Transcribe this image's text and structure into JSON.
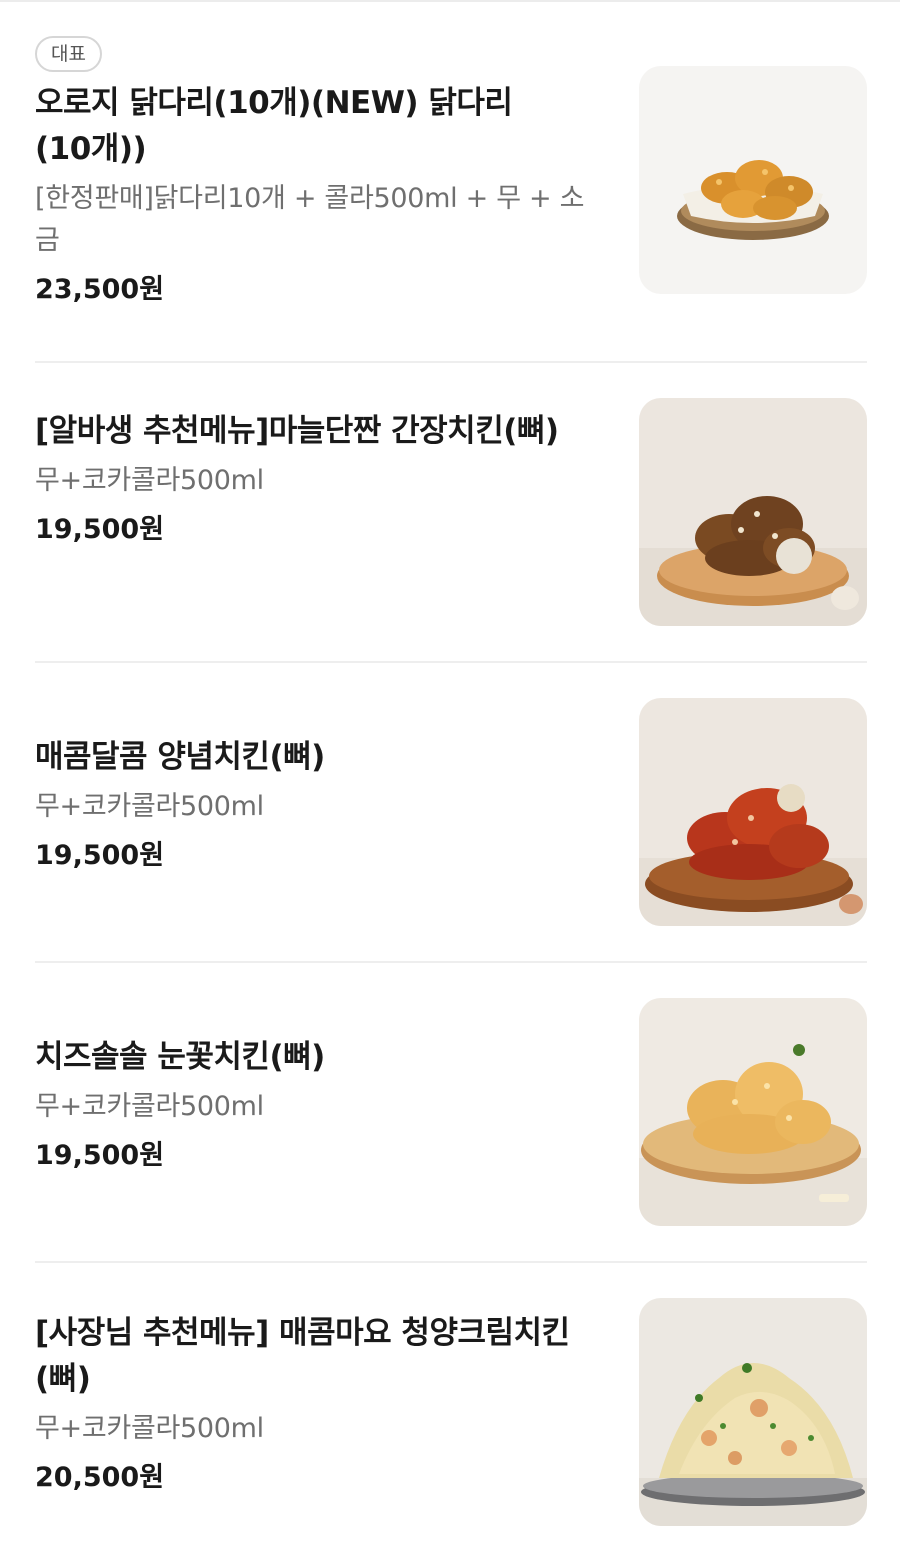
{
  "items": [
    {
      "badge": "대표",
      "name": "오로지 닭다리(10개)(NEW) 닭다리(10개))",
      "desc": "[한정판매]닭다리10개 + 콜라500ml + 무 + 소금",
      "price": "23,500원",
      "image_icon": "fried-drumsticks-basket-photo"
    },
    {
      "name": "[알바생 추천메뉴]마늘단짠 간장치킨(뼈)",
      "desc": "무+코카콜라500ml",
      "price": "19,500원",
      "image_icon": "garlic-soy-chicken-photo"
    },
    {
      "name": "매콤달콤 양념치킨(뼈)",
      "desc": "무+코카콜라500ml",
      "price": "19,500원",
      "image_icon": "seasoned-spicy-chicken-photo"
    },
    {
      "name": "치즈솔솔 눈꽃치킨(뼈)",
      "desc": "무+코카콜라500ml",
      "price": "19,500원",
      "image_icon": "cheese-snow-chicken-photo"
    },
    {
      "name": "[사장님 추천메뉴] 매콤마요 청양크림치킨(뼈)",
      "desc": "무+코카콜라500ml",
      "price": "20,500원",
      "image_icon": "spicy-mayo-cream-chicken-photo"
    }
  ]
}
